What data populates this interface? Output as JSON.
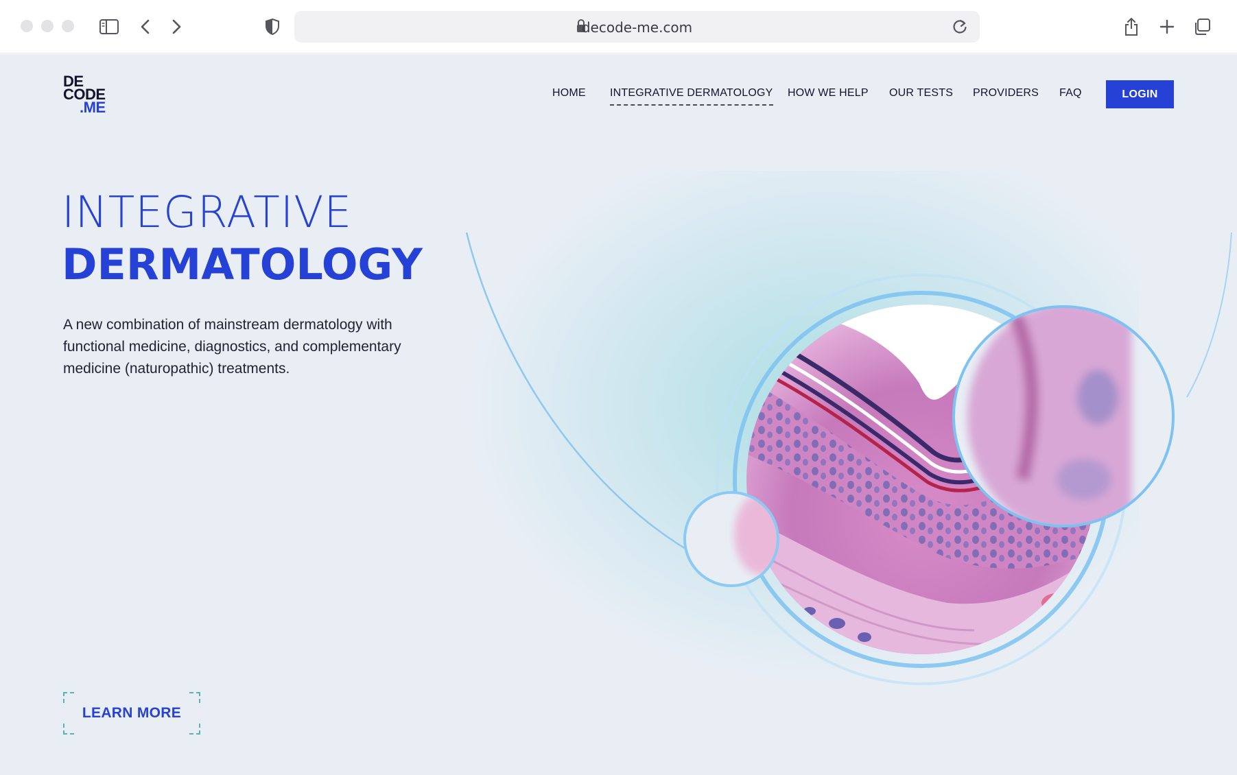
{
  "browser": {
    "url": "decode-me.com"
  },
  "logo": {
    "line1": "DE",
    "line2": "CODE",
    "line3": ".ME"
  },
  "nav": {
    "items": [
      {
        "label": "HOME"
      },
      {
        "label": "INTEGRATIVE DERMATOLOGY",
        "active": true
      },
      {
        "label": "HOW WE HELP"
      },
      {
        "label": "OUR TESTS"
      },
      {
        "label": "PROVIDERS"
      },
      {
        "label": "FAQ"
      }
    ],
    "login_label": "LOGIN"
  },
  "hero": {
    "title_line1": "INTEGRATIVE",
    "title_line2": "DERMATOLOGY",
    "description": "A new combination of mainstream dermatology with functional medicine, diagnostics, and complementary medicine (naturopathic) treatments.",
    "cta_label": "LEARN MORE"
  },
  "colors": {
    "brand_blue": "#2541d6",
    "page_background": "#e9eef5",
    "glow_teal": "#78d2d7"
  }
}
